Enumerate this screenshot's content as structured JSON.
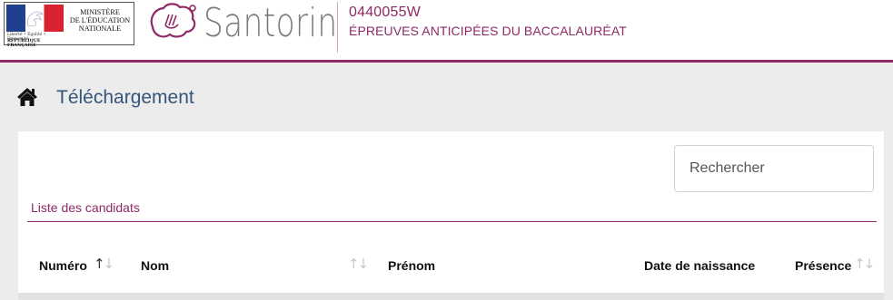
{
  "header": {
    "ministry_lines": [
      "MINISTÈRE",
      "DE L'ÉDUCATION",
      "NATIONALE"
    ],
    "ministry_motto": "Liberté • Égalité • Fraternité",
    "republic": "RÉPUBLIQUE FRANÇAISE",
    "app_name": "Santorin",
    "establishment_code": "0440055W",
    "exam_name": "ÉPREUVES ANTICIPÉES DU BACCALAURÉAT",
    "accent_color": "#8e2a66"
  },
  "page": {
    "title": "Téléchargement",
    "title_icon": "home-icon"
  },
  "search": {
    "placeholder": "Rechercher",
    "value": ""
  },
  "list": {
    "label": "Liste des candidats"
  },
  "table": {
    "columns": [
      {
        "key": "numero",
        "label": "Numéro",
        "sort_icon": "sort-asc-icon"
      },
      {
        "key": "nom",
        "label": "Nom",
        "sort_icon": "sort-icon"
      },
      {
        "key": "prenom",
        "label": "Prénom",
        "sort_icon": ""
      },
      {
        "key": "date_naissance",
        "label": "Date de naissance",
        "sort_icon": ""
      },
      {
        "key": "presence",
        "label": "Présence",
        "sort_icon": "sort-icon"
      }
    ]
  }
}
